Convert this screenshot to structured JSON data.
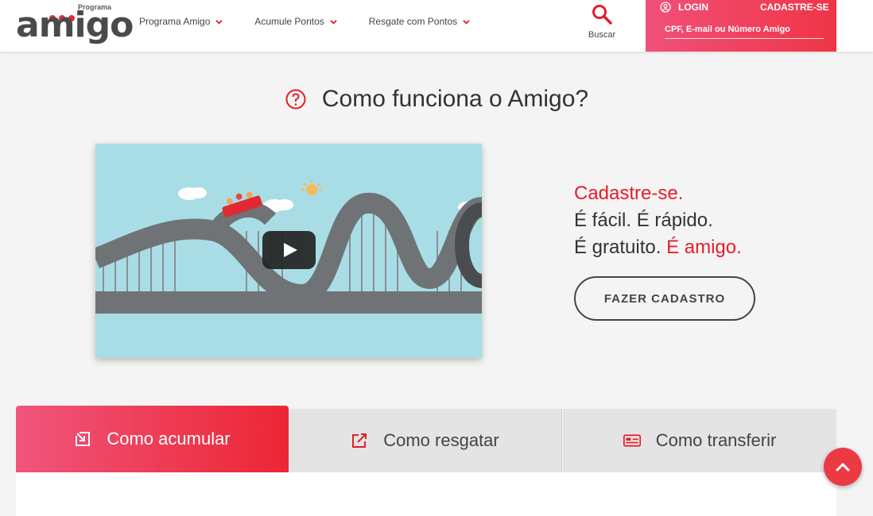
{
  "header": {
    "logo_small": "Programa",
    "logo_main": "amigo",
    "nav": [
      {
        "label": "Programa Amigo",
        "icon": "chevron-down-icon"
      },
      {
        "label": "Acumule Pontos",
        "icon": "chevron-down-icon"
      },
      {
        "label": "Resgate com Pontos",
        "icon": "chevron-down-icon"
      }
    ],
    "search_label": "Buscar",
    "login_label": "LOGIN",
    "signup_label": "CADASTRE-SE",
    "login_placeholder": "CPF, E-mail ou Número Amigo"
  },
  "main": {
    "title": "Como funciona o Amigo?",
    "promo": {
      "line1": "Cadastre-se.",
      "line2": "É fácil. É rápido.",
      "line3_a": "É gratuito.",
      "line3_b": "É amigo."
    },
    "cta_label": "FAZER CADASTRO"
  },
  "tabs": [
    {
      "label": "Como acumular",
      "icon": "arrow-in-box-icon",
      "active": true
    },
    {
      "label": "Como resgatar",
      "icon": "external-link-icon",
      "active": false
    },
    {
      "label": "Como transferir",
      "icon": "card-transfer-icon",
      "active": false
    }
  ],
  "colors": {
    "accent": "#e41e2b",
    "gradient_start": "#f0557c",
    "gradient_end": "#ec2634"
  }
}
